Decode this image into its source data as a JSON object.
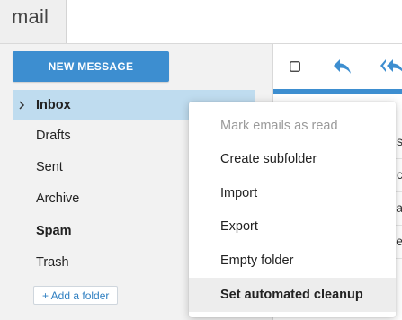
{
  "app": {
    "title": "mail"
  },
  "sidebar": {
    "new_message_label": "NEW MESSAGE",
    "add_folder_label": "+ Add a folder",
    "folders": [
      {
        "label": "Inbox",
        "bold": true,
        "selected": true
      },
      {
        "label": "Drafts",
        "bold": false,
        "selected": false
      },
      {
        "label": "Sent",
        "bold": false,
        "selected": false
      },
      {
        "label": "Archive",
        "bold": false,
        "selected": false
      },
      {
        "label": "Spam",
        "bold": true,
        "selected": false
      },
      {
        "label": "Trash",
        "bold": false,
        "selected": false
      }
    ]
  },
  "message_list": {
    "row_fragments": [
      "s",
      "c",
      "a",
      "e"
    ]
  },
  "context_menu": {
    "items": [
      {
        "label": "Mark emails as read",
        "disabled": true
      },
      {
        "label": "Create subfolder",
        "disabled": false
      },
      {
        "label": "Import",
        "disabled": false
      },
      {
        "label": "Export",
        "disabled": false
      },
      {
        "label": "Empty folder",
        "disabled": false
      },
      {
        "label": "Set automated cleanup",
        "disabled": false,
        "highlighted": true
      }
    ]
  },
  "colors": {
    "accent": "#3d8ed0",
    "selected_folder_bg": "#bfdcef",
    "menu_hover_bg": "#ededed",
    "disabled_text": "#9a9a9a"
  },
  "icons": {
    "folder_expand": "chevron-right-icon",
    "select_all": "checkbox-icon",
    "reply": "reply-icon",
    "reply_all": "reply-all-icon"
  }
}
